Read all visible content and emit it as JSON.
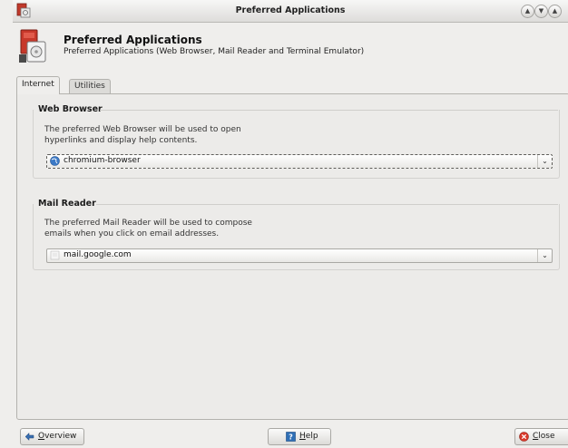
{
  "window": {
    "title": "Preferred Applications"
  },
  "header": {
    "title": "Preferred Applications",
    "subtitle": "Preferred Applications (Web Browser, Mail Reader and Terminal Emulator)"
  },
  "tabs": [
    {
      "label": "Internet",
      "active": true
    },
    {
      "label": "Utilities",
      "active": false
    }
  ],
  "web_browser": {
    "heading": "Web Browser",
    "description_line1": "The preferred Web Browser will be used to open",
    "description_line2": "hyperlinks and display help contents.",
    "selected": "chromium-browser"
  },
  "mail_reader": {
    "heading": "Mail Reader",
    "description_line1": "The preferred Mail Reader will be used to compose",
    "description_line2": "emails when you click on email addresses.",
    "selected": "mail.google.com"
  },
  "footer": {
    "overview_prefix": "",
    "overview_accel": "O",
    "overview_rest": "verview",
    "help_accel": "H",
    "help_rest": "elp",
    "close_accel": "C",
    "close_rest": "lose"
  },
  "icons": {
    "app": "preferences-icon",
    "help": "help-icon",
    "overview": "back-arrow-icon",
    "close": "close-icon",
    "browser": "globe-icon",
    "mail": "envelope-icon"
  },
  "colors": {
    "close_red": "#d9392b",
    "help_blue": "#2f6fb6",
    "globe_blue": "#3b79c6"
  }
}
